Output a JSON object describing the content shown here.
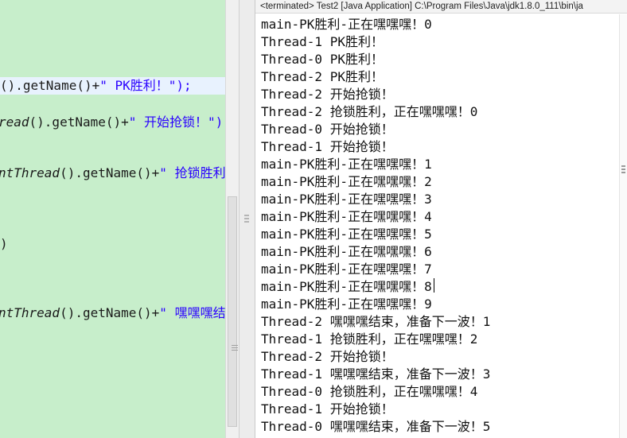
{
  "editor": {
    "lines": [
      {
        "plain": "().getName()+",
        "string": "\" PK胜利！\");"
      },
      {
        "italic": "read",
        "plain": "().getName()+",
        "string": "\" 开始抢锁！\")"
      },
      {
        "italic": "ntThread",
        "plain": "().getName()+",
        "string": "\" 抢锁胜利"
      },
      {
        "plain": ")"
      },
      {
        "italic": "ntThread",
        "plain": "().getName()+",
        "string": "\" 嘿嘿嘿结"
      }
    ]
  },
  "console": {
    "header": "<terminated> Test2 [Java Application] C:\\Program Files\\Java\\jdk1.8.0_111\\bin\\ja",
    "lines": [
      "main-PK胜利-正在嘿嘿嘿！0",
      "Thread-1 PK胜利！",
      "Thread-0 PK胜利！",
      "Thread-2 PK胜利！",
      "Thread-2 开始抢锁！",
      "Thread-2 抢锁胜利，正在嘿嘿嘿！0",
      "Thread-0 开始抢锁！",
      "Thread-1 开始抢锁！",
      "main-PK胜利-正在嘿嘿嘿！1",
      "main-PK胜利-正在嘿嘿嘿！2",
      "main-PK胜利-正在嘿嘿嘿！3",
      "main-PK胜利-正在嘿嘿嘿！4",
      "main-PK胜利-正在嘿嘿嘿！5",
      "main-PK胜利-正在嘿嘿嘿！6",
      "main-PK胜利-正在嘿嘿嘿！7",
      "main-PK胜利-正在嘿嘿嘿！8",
      "main-PK胜利-正在嘿嘿嘿！9",
      "Thread-2 嘿嘿嘿结束，准备下一波！1",
      "Thread-1 抢锁胜利，正在嘿嘿嘿！2",
      "Thread-2 开始抢锁！",
      "Thread-1 嘿嘿嘿结束，准备下一波！3",
      "Thread-0 抢锁胜利，正在嘿嘿嘿！4",
      "Thread-1 开始抢锁！",
      "Thread-0 嘿嘿嘿结束，准备下一波！5"
    ]
  }
}
